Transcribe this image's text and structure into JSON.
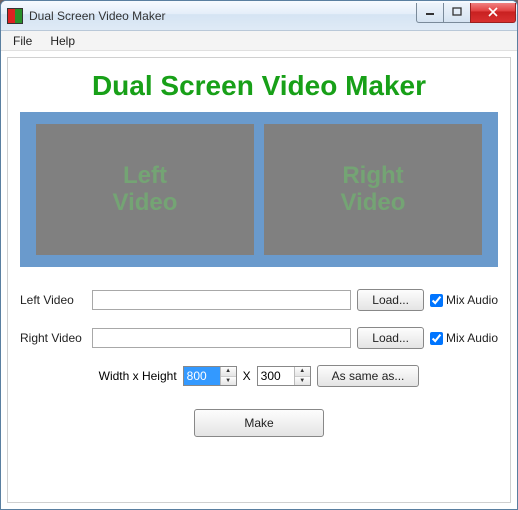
{
  "window": {
    "title": "Dual Screen Video Maker"
  },
  "menu": {
    "file": "File",
    "help": "Help"
  },
  "heading": "Dual Screen Video Maker",
  "preview": {
    "left": "Left\nVideo",
    "right": "Right\nVideo"
  },
  "rows": {
    "left": {
      "label": "Left Video",
      "value": "",
      "load": "Load...",
      "mix_checked": true,
      "mix_label": "Mix Audio"
    },
    "right": {
      "label": "Right Video",
      "value": "",
      "load": "Load...",
      "mix_checked": true,
      "mix_label": "Mix Audio"
    }
  },
  "dimensions": {
    "label": "Width x Height",
    "width": "800",
    "sep": "X",
    "height": "300",
    "same": "As same as..."
  },
  "make": "Make"
}
